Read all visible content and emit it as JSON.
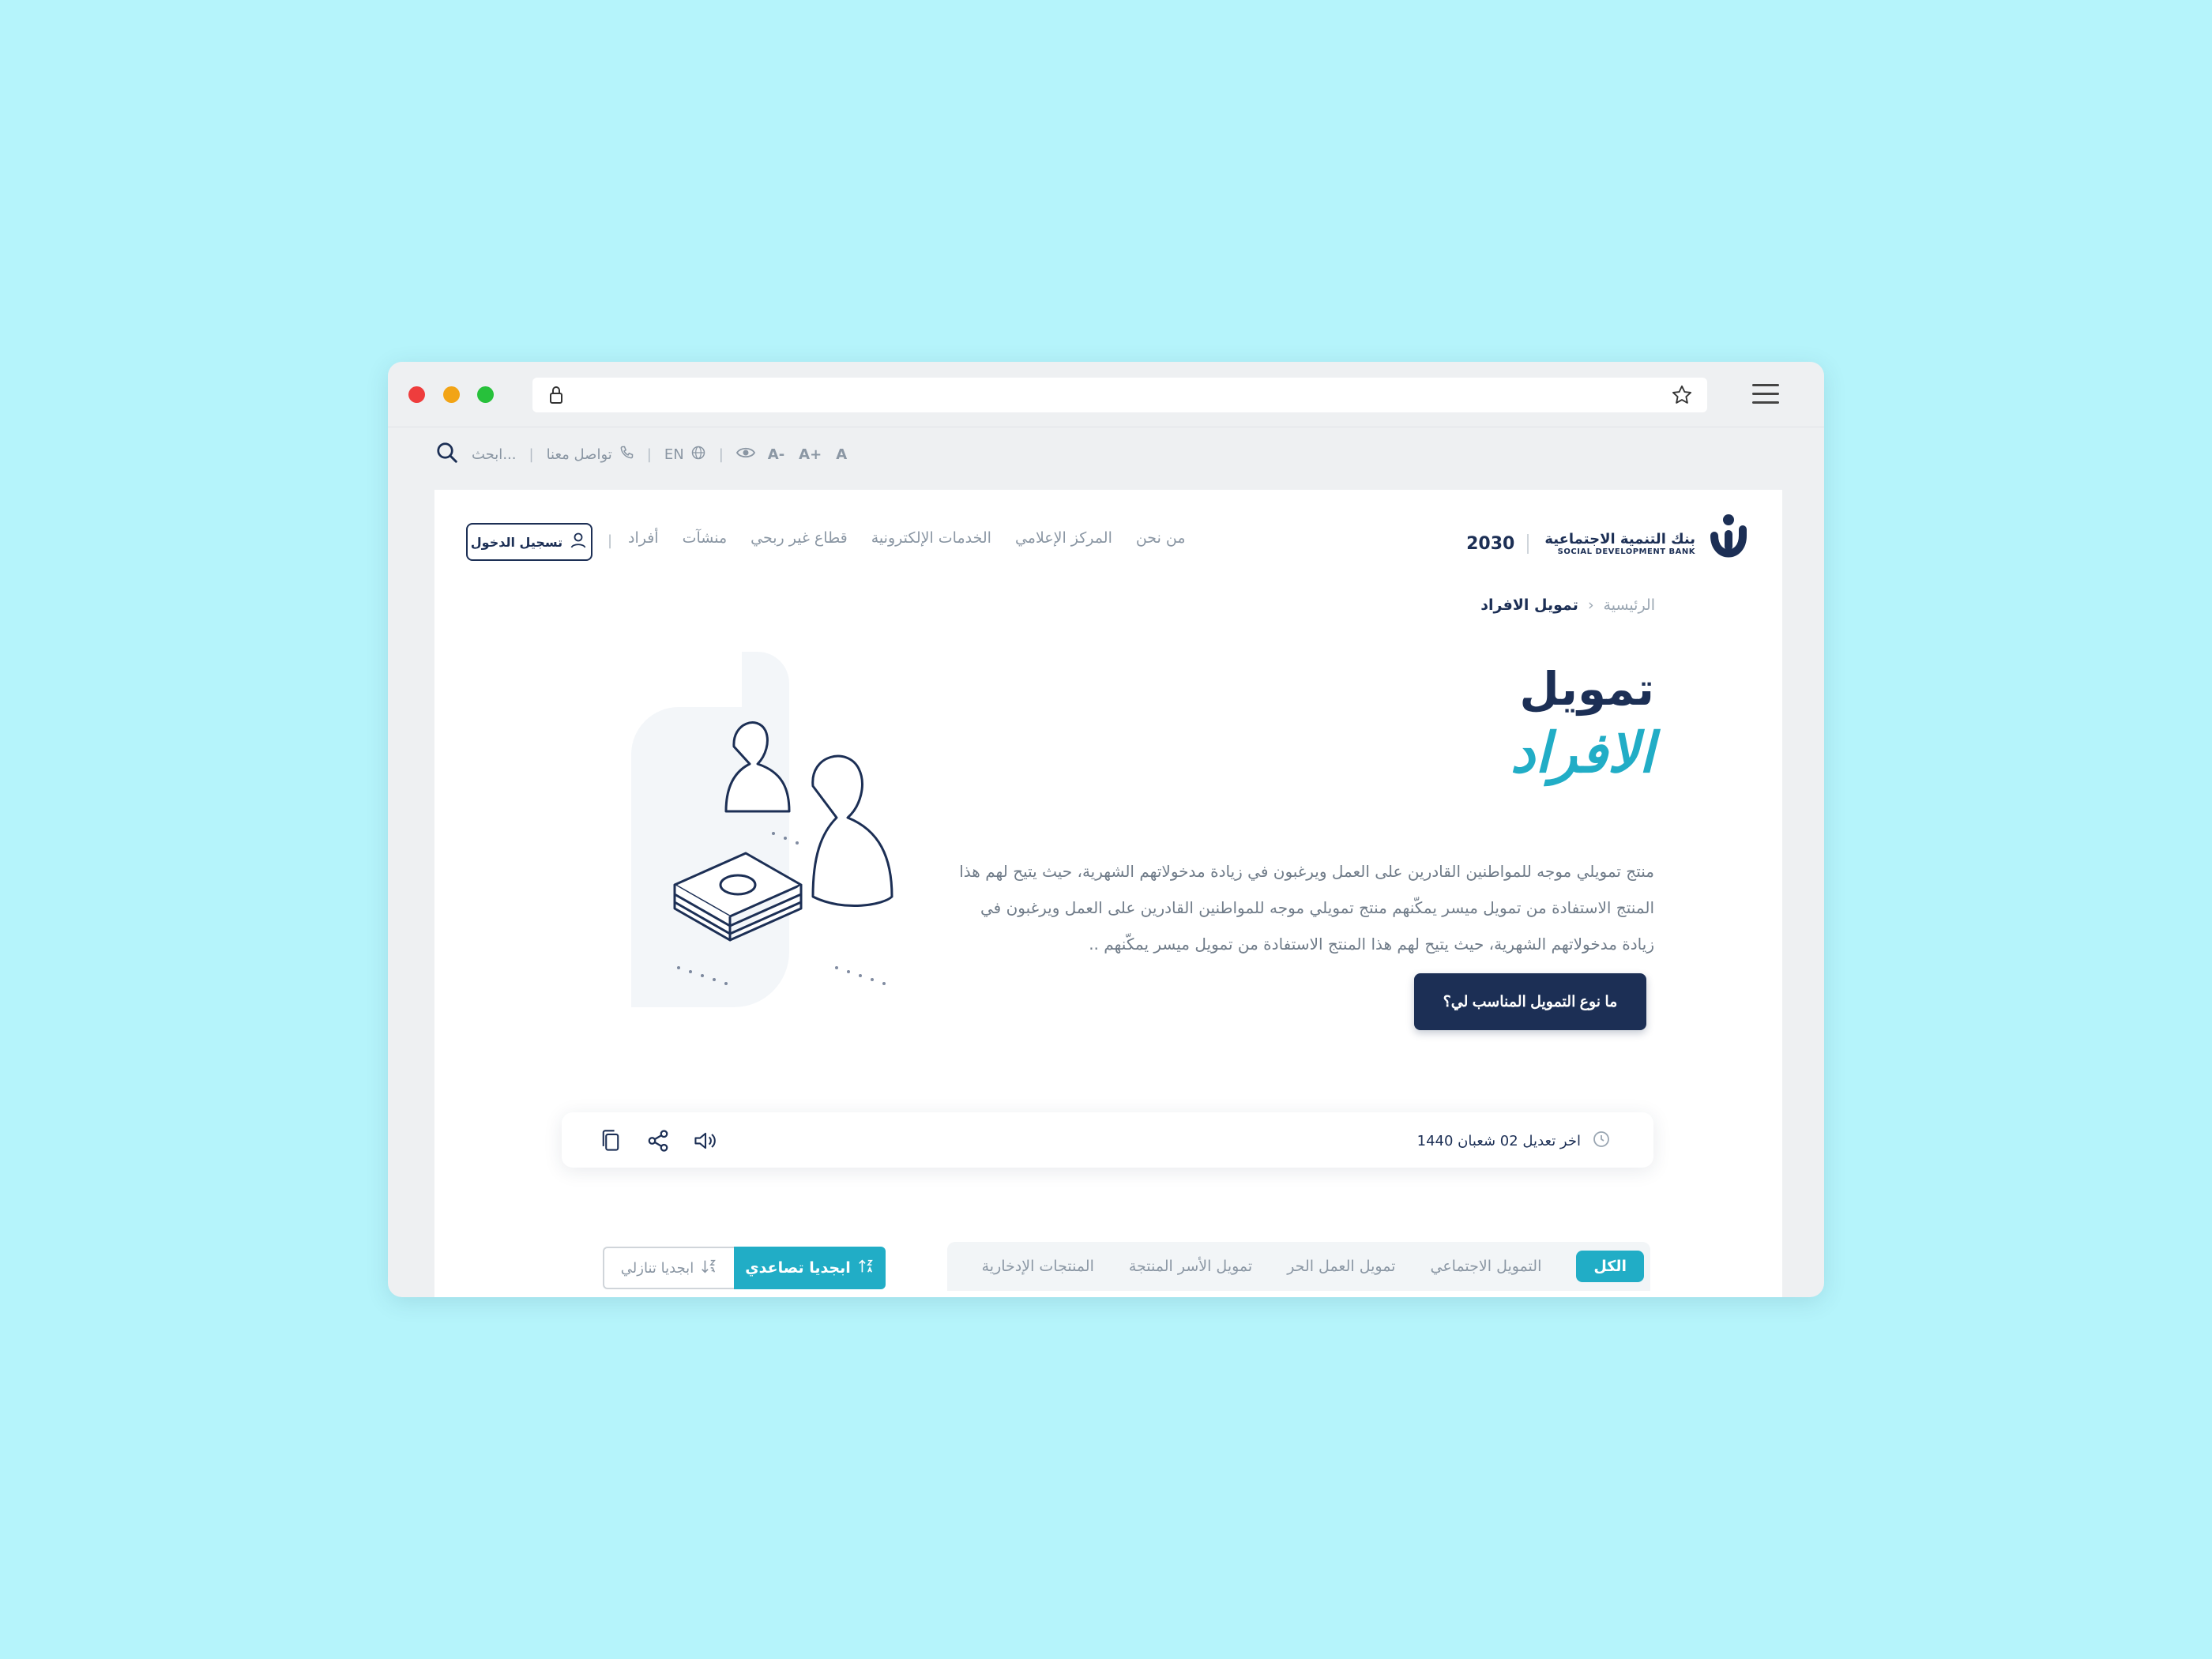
{
  "browser": {
    "traffic_lights": [
      "close",
      "minimize",
      "maximize"
    ],
    "icons": {
      "lock": "lock-icon",
      "star": "star-icon",
      "menu": "hamburger-menu-icon"
    }
  },
  "topbar": {
    "search_placeholder": "ابحث...",
    "contact": "تواصل معنا",
    "language": "EN",
    "font_sizes": [
      "A",
      "A+",
      "A-"
    ],
    "separator": "|"
  },
  "header": {
    "logo_ar": "بنك التنمية الاجتماعية",
    "logo_en": "SOCIAL DEVELOPMENT BANK",
    "vision": "2030",
    "login": "تسجيل الدخول",
    "nav": [
      "أفراد",
      "منشآت",
      "قطاع غير ربحي",
      "الخدمات الإلكترونية",
      "المركز الإعلامي",
      "من نحن"
    ]
  },
  "breadcrumb": {
    "home": "الرئيسية",
    "current": "تمويل الافراد",
    "chevron": "‹"
  },
  "hero": {
    "title_line1": "تمويل",
    "title_line2": "الافراد",
    "description": "منتج تمويلي موجه للمواطنين القادرين على العمل ويرغبون في زيادة مدخولاتهم الشهرية، حيث يتيح لهم هذا المنتج الاستفادة من تمويل ميسر يمكّنهم منتج تمويلي موجه للمواطنين القادرين على العمل ويرغبون في زيادة مدخولاتهم الشهرية، حيث يتيح لهم هذا المنتج الاستفادة من تمويل ميسر يمكّنهم ..",
    "cta": "ما نوع التمويل المناسب لي؟"
  },
  "meta": {
    "last_modified": "اخر تعديل 02 شعبان 1440"
  },
  "filters": {
    "tabs": [
      "الكل",
      "التمويل الاجتماعي",
      "تمويل العمل الحر",
      "تمويل الأسر المنتجة",
      "المنتجات الإدخارية"
    ],
    "active_index": 0,
    "sort_asc": "ابجديا تصاعدي",
    "sort_desc": "ابجديا تنازلي"
  },
  "colors": {
    "navy": "#1c2f55",
    "teal": "#21adc6",
    "background": "#b5f4fb"
  }
}
